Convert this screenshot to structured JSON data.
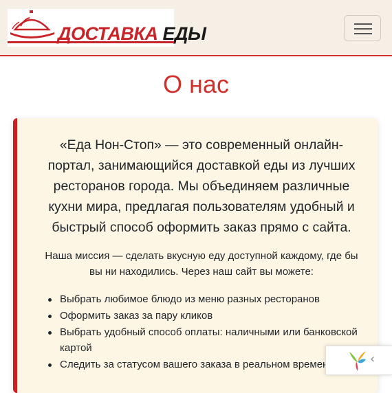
{
  "brand": {
    "word1": "ДОСТАВКА",
    "word2": "ЕДЫ",
    "logo_icon": "cloche-icon",
    "accent_color": "#c8252b"
  },
  "nav": {
    "toggler_icon": "hamburger-menu-icon"
  },
  "page": {
    "title": "О нас"
  },
  "about": {
    "lead": "«Еда Нон-Стоп» — это современный онлайн-портал, занимающийся доставкой еды из лучших ресторанов города. Мы объединяем различные кухни мира, предлагая пользователям удобный и быстрый способ оформить заказ прямо с сайта.",
    "mission": "Наша миссия — сделать вкусную еду доступной каждому, где бы вы ни находились. Через наш сайт вы можете:",
    "features": [
      "Выбрать любимое блюдо из меню разных ресторанов",
      "Оформить заказ за пару кликов",
      "Выбрать удобный способ оплаты: наличными или банковской картой",
      "Следить за статусом вашего заказа в реальном времени"
    ]
  },
  "widget": {
    "logo_icon": "yii-logo-icon",
    "toggle": "‹"
  }
}
